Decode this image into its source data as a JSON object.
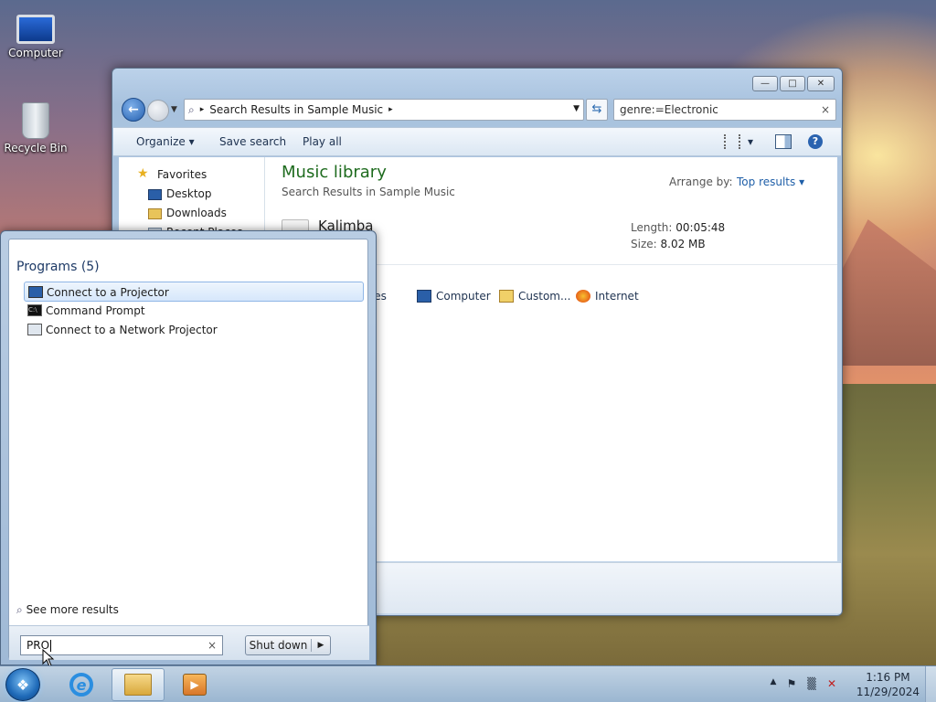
{
  "desktop": {
    "icons": [
      {
        "label": "Computer"
      },
      {
        "label": "Recycle Bin"
      }
    ]
  },
  "explorer": {
    "controls": {
      "minimize": "—",
      "maximize": "□",
      "close": "✕"
    },
    "address": {
      "search_glyph": "⌕",
      "breadcrumb": "Search Results in Sample Music",
      "sep": "▸",
      "dropdown": "▼"
    },
    "refresh_glyph": "⇆",
    "search": {
      "value": "genre:=Electronic",
      "clear": "×"
    },
    "toolbar": {
      "organize": "Organize ▾",
      "save_search": "Save search",
      "play_all": "Play all",
      "views_dropdown": "▾",
      "help": "?"
    },
    "nav_pane": {
      "favorites": "Favorites",
      "items": [
        "Desktop",
        "Downloads",
        "Recent Places"
      ]
    },
    "content": {
      "title": "Music library",
      "subtitle": "Search Results in Sample Music",
      "arrange_label": "Arrange by:",
      "arrange_value": "Top results ▾",
      "result": {
        "name": "Kalimba",
        "length_label": "Length:",
        "length_value": "00:05:48",
        "size_label": "Size:",
        "size_value": "8.02 MB"
      },
      "search_again": [
        "Libraries",
        "Computer",
        "Custom...",
        "Internet"
      ]
    }
  },
  "start_menu": {
    "group_title": "Programs (5)",
    "items": [
      {
        "label": "Connect to a Projector",
        "selected": true
      },
      {
        "label": "Command Prompt",
        "selected": false
      },
      {
        "label": "Connect to a Network Projector",
        "selected": false
      }
    ],
    "see_more": "See more results",
    "search_value": "PRO",
    "search_clear": "×",
    "shutdown_label": "Shut down",
    "shutdown_arrow": "▶"
  },
  "taskbar": {
    "start_glyph": "❖",
    "ie_glyph": "e",
    "media_glyph": "▶",
    "tray": {
      "show_hidden": "▲",
      "flag": "⚑",
      "network": "▒",
      "volume": "✕"
    },
    "clock": {
      "time": "1:16 PM",
      "date": "11/29/2024"
    }
  }
}
